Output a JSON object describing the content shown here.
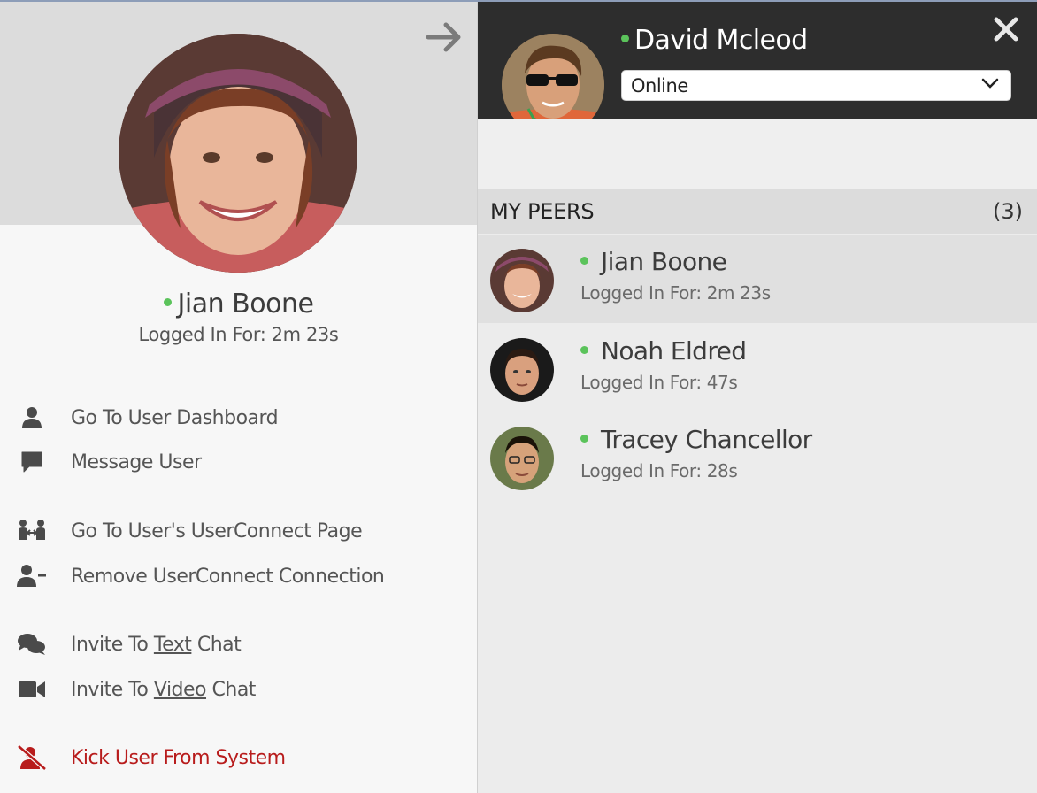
{
  "profile": {
    "name": "Jian Boone",
    "logged_in": "Logged In For: 2m 23s",
    "status_color": "#5bc35b"
  },
  "actions": {
    "dashboard": "Go To User Dashboard",
    "message": "Message User",
    "userconnect_page": "Go To User's UserConnect Page",
    "remove_connection": "Remove UserConnect Connection",
    "invite_text_prefix": "Invite To ",
    "invite_text_link": "Text",
    "invite_text_suffix": " Chat",
    "invite_video_prefix": "Invite To ",
    "invite_video_link": "Video",
    "invite_video_suffix": " Chat",
    "kick": "Kick User From System"
  },
  "current_user": {
    "name": "David Mcleod",
    "status": "Online"
  },
  "peers": {
    "title": "MY PEERS",
    "count": "(3)",
    "items": [
      {
        "name": "Jian Boone",
        "logged_in": "Logged In For: 2m 23s"
      },
      {
        "name": "Noah Eldred",
        "logged_in": "Logged In For: 47s"
      },
      {
        "name": "Tracey Chancellor",
        "logged_in": "Logged In For: 28s"
      }
    ]
  },
  "colors": {
    "online": "#5bc35b",
    "danger": "#b81c1c",
    "header_bg": "#2d2d2d"
  },
  "icons": {
    "collapse": "arrow-right-icon",
    "close": "close-icon",
    "dropdown": "chevron-down-icon",
    "dashboard": "user-icon",
    "message": "message-bubble-icon",
    "userconnect": "user-connect-icon",
    "remove": "user-minus-icon",
    "text_chat": "chat-bubbles-icon",
    "video_chat": "video-camera-icon",
    "kick": "user-slash-icon"
  }
}
